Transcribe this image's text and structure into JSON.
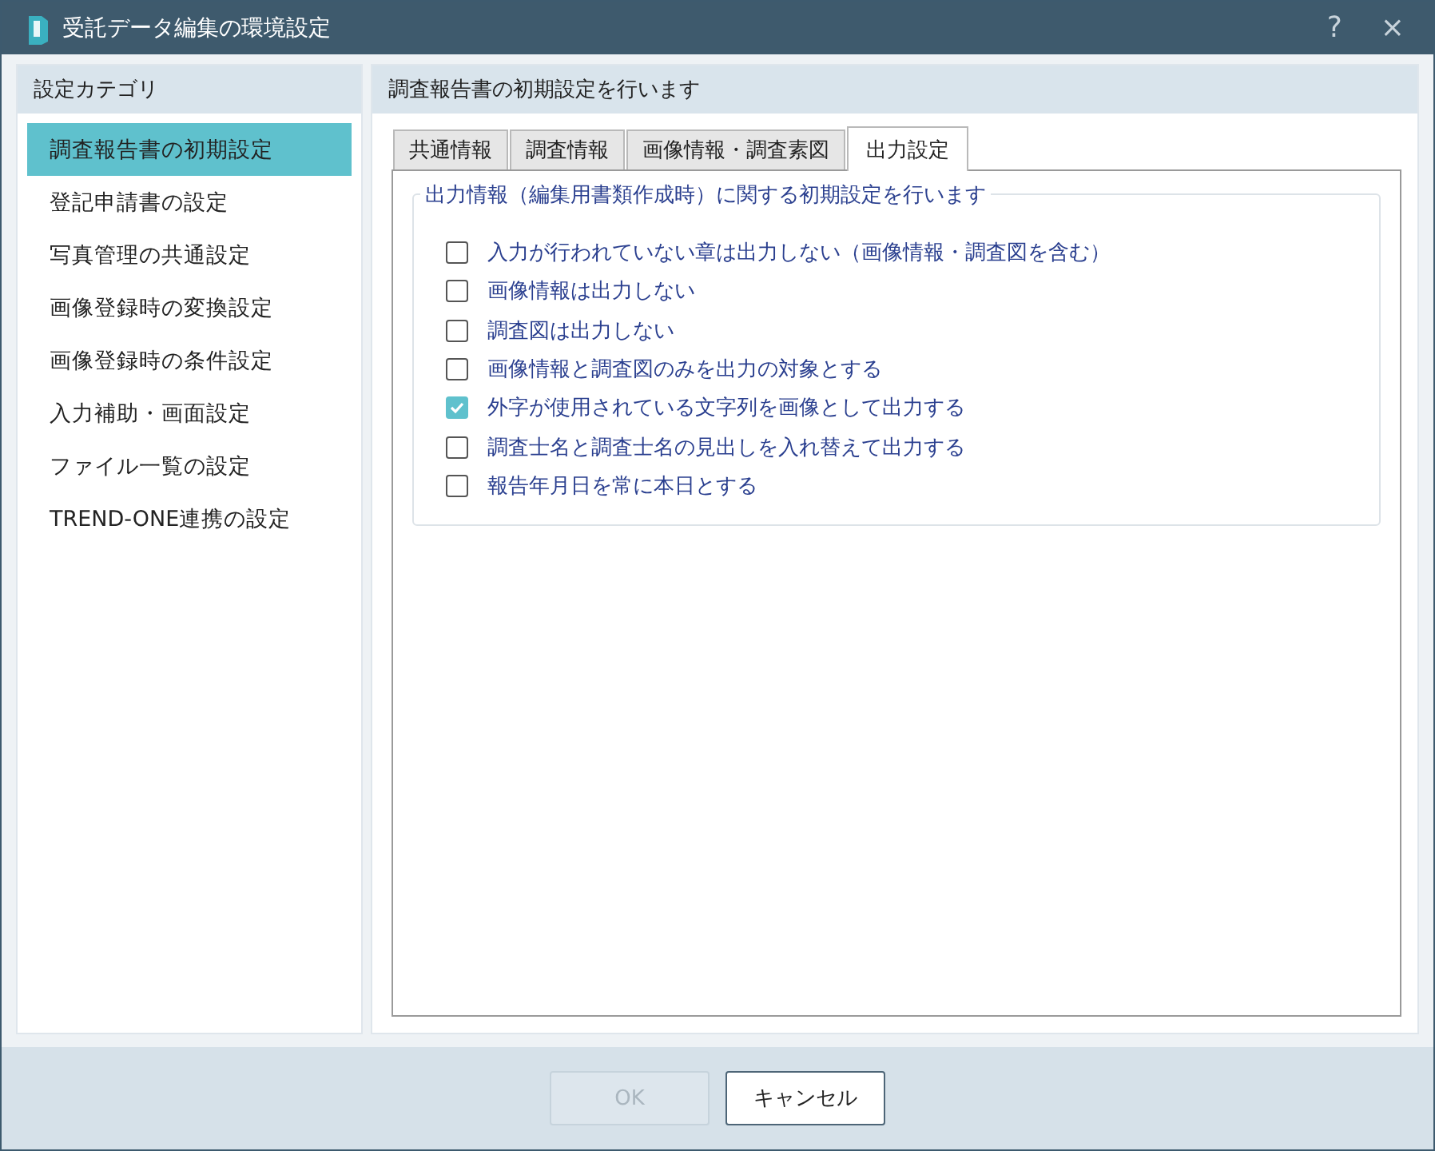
{
  "window": {
    "title": "受託データ編集の環境設定",
    "help": "?",
    "close": "×"
  },
  "sidebar": {
    "title": "設定カテゴリ",
    "items": [
      {
        "label": "調査報告書の初期設定",
        "selected": true
      },
      {
        "label": "登記申請書の設定",
        "selected": false
      },
      {
        "label": "写真管理の共通設定",
        "selected": false
      },
      {
        "label": "画像登録時の変換設定",
        "selected": false
      },
      {
        "label": "画像登録時の条件設定",
        "selected": false
      },
      {
        "label": "入力補助・画面設定",
        "selected": false
      },
      {
        "label": "ファイル一覧の設定",
        "selected": false
      },
      {
        "label": "TREND-ONE連携の設定",
        "selected": false
      }
    ]
  },
  "main": {
    "title": "調査報告書の初期設定を行います",
    "tabs": [
      {
        "label": "共通情報",
        "selected": false
      },
      {
        "label": "調査情報",
        "selected": false
      },
      {
        "label": "画像情報・調査素図",
        "selected": false
      },
      {
        "label": "出力設定",
        "selected": true
      }
    ],
    "group": {
      "title": "出力情報（編集用書類作成時）に関する初期設定を行います",
      "options": [
        {
          "label": "入力が行われていない章は出力しない（画像情報・調査図を含む）",
          "checked": false
        },
        {
          "label": "画像情報は出力しない",
          "checked": false
        },
        {
          "label": "調査図は出力しない",
          "checked": false
        },
        {
          "label": "画像情報と調査図のみを出力の対象とする",
          "checked": false
        },
        {
          "label": "外字が使用されている文字列を画像として出力する",
          "checked": true
        },
        {
          "label": "調査士名と調査士名の見出しを入れ替えて出力する",
          "checked": false
        },
        {
          "label": "報告年月日を常に本日とする",
          "checked": false
        }
      ]
    }
  },
  "buttons": [
    {
      "label": "OK",
      "disabled": true
    },
    {
      "label": "キャンセル",
      "disabled": false
    }
  ]
}
